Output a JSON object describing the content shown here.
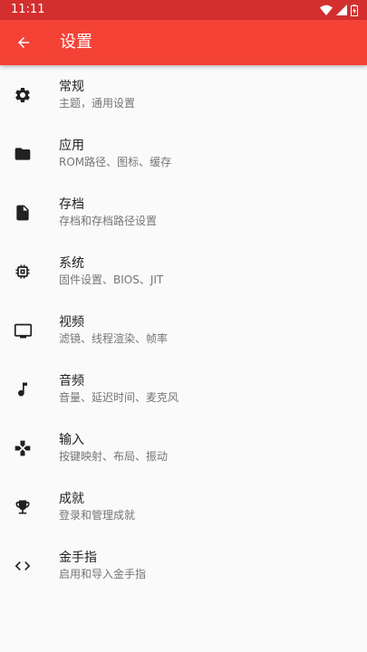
{
  "status_bar": {
    "time": "11:11"
  },
  "app_bar": {
    "title": "设置"
  },
  "colors": {
    "status_bar": "#d32f2f",
    "app_bar": "#f44336",
    "icon": "#212121",
    "title_text": "#212121",
    "subtitle_text": "#757575"
  },
  "settings": [
    {
      "title": "常规",
      "subtitle": "主题，通用设置",
      "icon": "gear-icon"
    },
    {
      "title": "应用",
      "subtitle": "ROM路径、图标、缓存",
      "icon": "folder-icon"
    },
    {
      "title": "存档",
      "subtitle": "存档和存档路径设置",
      "icon": "file-icon"
    },
    {
      "title": "系统",
      "subtitle": "固件设置、BIOS、JIT",
      "icon": "chip-icon"
    },
    {
      "title": "视频",
      "subtitle": "滤镜、线程渲染、帧率",
      "icon": "monitor-icon"
    },
    {
      "title": "音频",
      "subtitle": "音量、延迟时间、麦克风",
      "icon": "music-note-icon"
    },
    {
      "title": "输入",
      "subtitle": "按键映射、布局、振动",
      "icon": "gamepad-icon"
    },
    {
      "title": "成就",
      "subtitle": "登录和管理成就",
      "icon": "trophy-icon"
    },
    {
      "title": "金手指",
      "subtitle": "启用和导入金手指",
      "icon": "code-icon"
    }
  ]
}
